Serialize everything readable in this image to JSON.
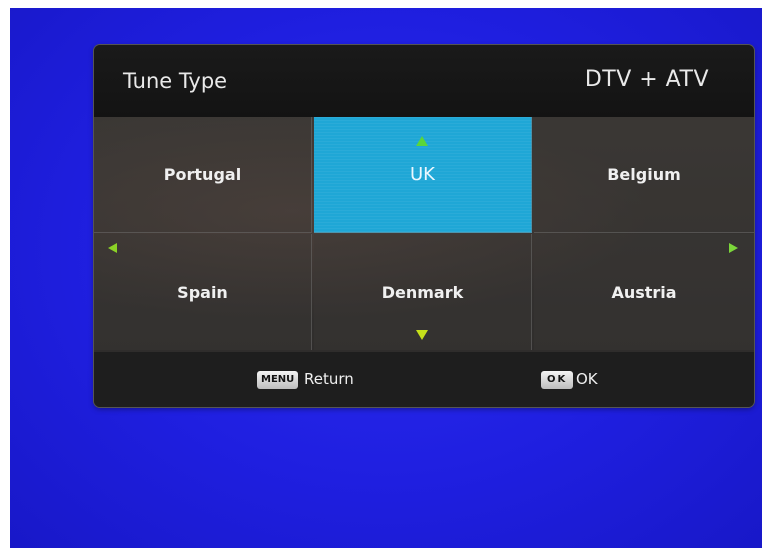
{
  "dialog": {
    "title": "Tune Type",
    "mode": "DTV + ATV"
  },
  "grid": {
    "cells": [
      {
        "label": "Portugal",
        "selected": false
      },
      {
        "label": "UK",
        "selected": true
      },
      {
        "label": "Belgium",
        "selected": false
      },
      {
        "label": "Spain",
        "selected": false
      },
      {
        "label": "Denmark",
        "selected": false
      },
      {
        "label": "Austria",
        "selected": false
      }
    ]
  },
  "footer": {
    "menu_key": "MENU",
    "menu_label": "Return",
    "ok_key": "OK",
    "ok_label": "OK"
  },
  "colors": {
    "screen_background": "#1f1fe0",
    "selected_cell": "#1fa7d6",
    "arrow_green": "#5bd63a",
    "arrow_yellow": "#c6e01a"
  },
  "icons": [
    "arrow-up-icon",
    "arrow-down-icon",
    "arrow-left-icon",
    "arrow-right-icon"
  ]
}
